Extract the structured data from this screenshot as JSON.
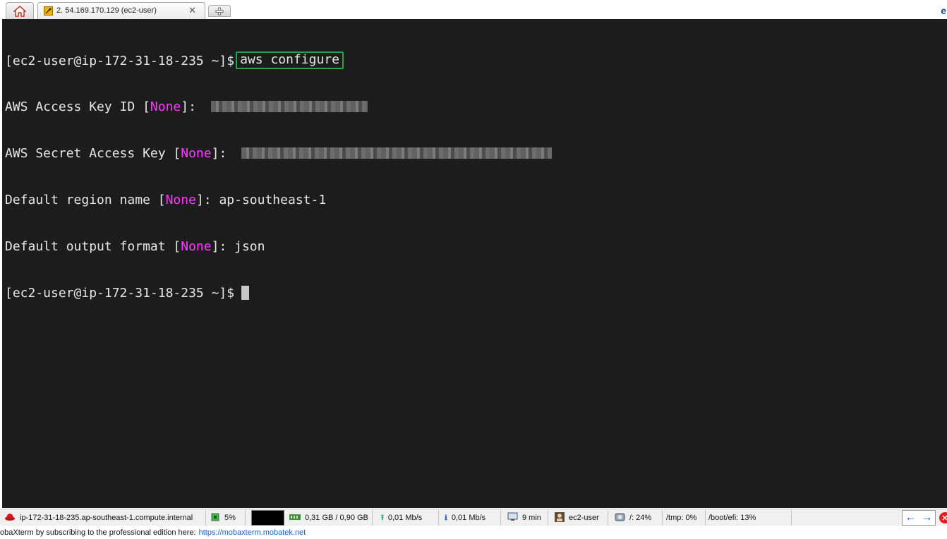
{
  "tabs": {
    "home_icon": "home-icon",
    "active_tab": {
      "title": "2. 54.169.170.129 (ec2-user)",
      "close": "✕",
      "icon": "wrench-icon"
    },
    "new_tab_icon": "plus-icon",
    "corner_logo": "e"
  },
  "terminal": {
    "prompt": "[ec2-user@ip-172-31-18-235 ~]$",
    "command": "aws configure",
    "lines": [
      {
        "label": "AWS Access Key ID [",
        "none": "None",
        "suffix": "]: ",
        "value": ""
      },
      {
        "label": "AWS Secret Access Key [",
        "none": "None",
        "suffix": "]: ",
        "value": ""
      },
      {
        "label": "Default region name [",
        "none": "None",
        "suffix": "]: ",
        "value": "ap-southeast-1"
      },
      {
        "label": "Default output format [",
        "none": "None",
        "suffix": "]: ",
        "value": "json"
      }
    ],
    "colors": {
      "background": "#1c1c1c",
      "text": "#e6e6e6",
      "none_highlight": "#ff3bff",
      "command_box": "#21a84a"
    }
  },
  "statusbar": {
    "host": "ip-172-31-18-235.ap-southeast-1.compute.internal",
    "cpu": "5%",
    "memory": "0,31 GB / 0,90 GB",
    "upload": "0,01 Mb/s",
    "download": "0,01 Mb/s",
    "uptime": "9 min",
    "user": "ec2-user",
    "disk_root": "/: 24%",
    "disk_tmp": "/tmp: 0%",
    "disk_boot": "/boot/efi: 13%",
    "nav_left": "←",
    "nav_right": "→",
    "stop": "✕"
  },
  "footer": {
    "text": "obaXterm by subscribing to the professional edition here:",
    "link": "https://mobaxterm.mobatek.net"
  }
}
